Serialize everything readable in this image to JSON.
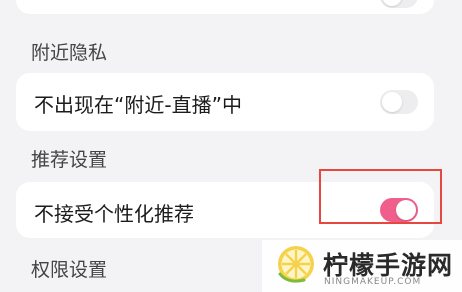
{
  "sections": {
    "nearby_privacy": "附近隐私",
    "recommend_settings": "推荐设置",
    "permission_settings": "权限设置"
  },
  "rows": {
    "hide_nearby_live": {
      "label": "不出现在“附近-直播”中",
      "toggle_state": "off"
    },
    "no_personalized_recommend": {
      "label": "不接受个性化推荐",
      "toggle_state": "on"
    }
  },
  "colors": {
    "toggle_on": "#f05f8c",
    "toggle_off": "#ededef",
    "highlight_border": "#e8473f",
    "page_background": "#f3f3f5"
  },
  "watermark": {
    "title": "柠檬手游网",
    "subtitle": "NINGMAKEUP.COM",
    "logo_icon": "lemon-slice-icon"
  }
}
